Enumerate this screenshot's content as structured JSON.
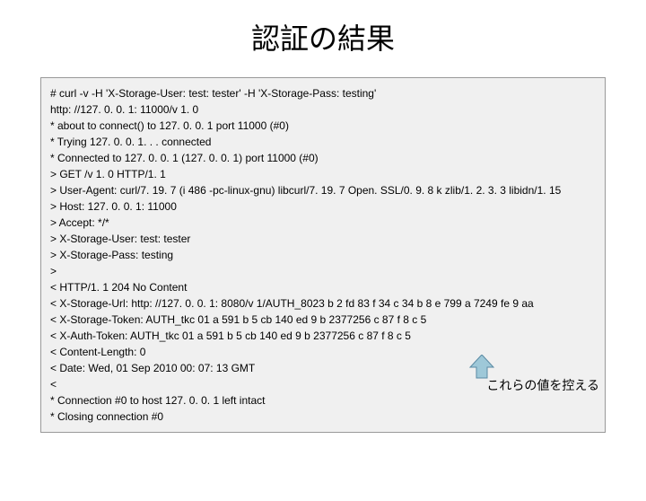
{
  "title": "認証の結果",
  "annotation": "これらの値を控える",
  "lines": [
    "# curl -v -H 'X-Storage-User: test: tester' -H 'X-Storage-Pass: testing'",
    "http: //127. 0. 0. 1: 11000/v 1. 0",
    "* about to connect() to 127. 0. 0. 1 port 11000 (#0)",
    "* Trying 127. 0. 0. 1. . . connected",
    "* Connected to 127. 0. 0. 1 (127. 0. 0. 1) port 11000 (#0)",
    "> GET /v 1. 0 HTTP/1. 1",
    "> User-Agent: curl/7. 19. 7 (i 486 -pc-linux-gnu) libcurl/7. 19. 7 Open. SSL/0. 9. 8 k zlib/1. 2. 3. 3 libidn/1. 15",
    "> Host: 127. 0. 0. 1: 11000",
    "> Accept: */*",
    "> X-Storage-User: test: tester",
    "> X-Storage-Pass: testing",
    ">",
    "< HTTP/1. 1 204 No Content",
    "< X-Storage-Url: http: //127. 0. 0. 1: 8080/v 1/AUTH_8023 b 2 fd 83 f 34 c 34 b 8 e 799 a 7249 fe 9 aa",
    "< X-Storage-Token: AUTH_tkc 01 a 591 b 5 cb 140 ed 9 b 2377256 c 87 f 8 c 5",
    "< X-Auth-Token: AUTH_tkc 01 a 591 b 5 cb 140 ed 9 b 2377256 c 87 f 8 c 5",
    "< Content-Length: 0",
    "< Date: Wed, 01 Sep 2010 00: 07: 13 GMT",
    "<",
    "* Connection #0 to host 127. 0. 0. 1 left intact",
    "* Closing connection #0"
  ]
}
